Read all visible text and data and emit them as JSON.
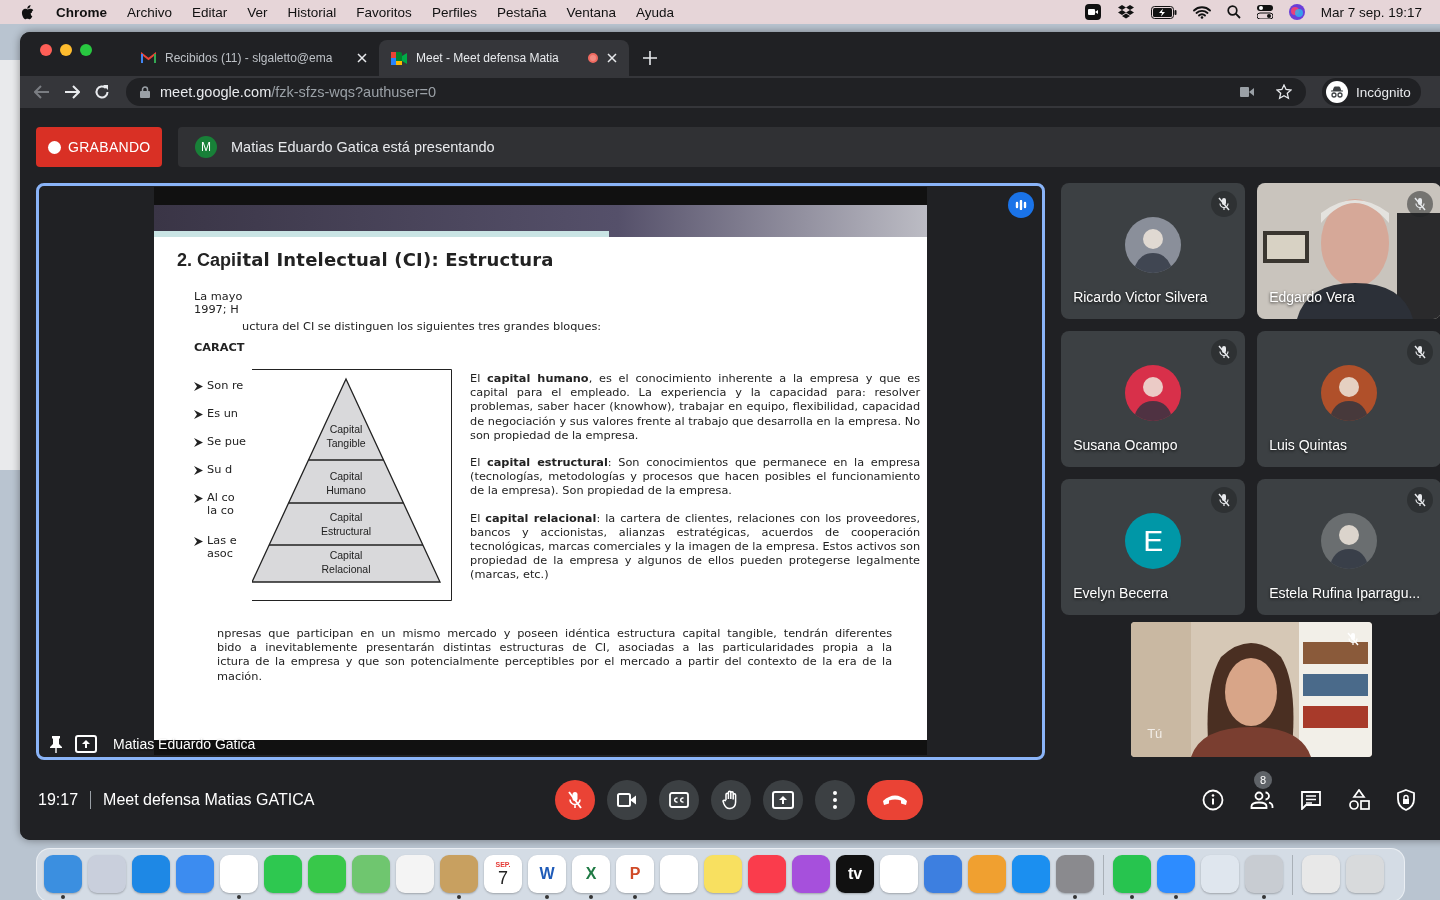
{
  "menubar": {
    "app": "Chrome",
    "items": [
      "Archivo",
      "Editar",
      "Ver",
      "Historial",
      "Favoritos",
      "Perfiles",
      "Pestaña",
      "Ventana",
      "Ayuda"
    ],
    "clock": "Mar 7 sep.  19:17"
  },
  "tabs": [
    {
      "kind": "mail",
      "title": "Recibidos (11) - slgaletto@ema",
      "selected": false,
      "recording": false
    },
    {
      "kind": "meet",
      "title": "Meet - Meet defensa Matia",
      "selected": true,
      "recording": true
    }
  ],
  "address": {
    "host": "meet.google.com",
    "path": "/fzk-sfzs-wqs?authuser=0",
    "profile": "Incógnito"
  },
  "meet": {
    "recording_label": "GRABANDO",
    "presenter_initial": "M",
    "presenter_text": "Matias Eduardo Gatica está presentando",
    "presenter_name": "Matias Eduardo Gatica",
    "time": "19:17",
    "meeting_title": "Meet defensa Matias GATICA",
    "people_count": "8",
    "mic_muted": true,
    "self_label": "Tú"
  },
  "slide": {
    "title_a": "2. Capi",
    "title_b": "ital Intelectual (CI): Estructura",
    "intro": "La mayo\n1997; H",
    "intro_2": "uctura del CI se distinguen los siguientes tres grandes bloques:",
    "heading": "CARACT",
    "bullets": [
      "Son re",
      "Es un",
      "Se pue",
      "Su d",
      "Al co\nla co",
      "Las e\nasoc"
    ],
    "pyramid": [
      "Capital\nTangible",
      "Capital\nHumano",
      "Capital\nEstructural",
      "Capital\nRelacional"
    ],
    "paragraphs": [
      "El **capital humano**, es el conocimiento inherente a la empresa y que es capital para el empleado. La experiencia y la capacidad para: resolver problemas, saber hacer (knowhow), trabajar en equipo, flexibilidad, capacidad de negociación y sus valores frente al trabajo que desarrolla en la empresa. No son propiedad de la empresa.",
      "El **capital estructural**: Son conocimientos que permanece en la empresa (tecnologías, metodologías y procesos que hacen posibles el funcionamiento de la empresa). Son propiedad de la empresa.",
      "El **capital relacional**: la cartera de clientes, relaciones con los proveedores, bancos y accionistas, alianzas estratégicas, acuerdos de cooperación tecnológicas, marcas comerciales y la imagen de la empresa. Estos activos son propiedad de la empresa y algunos de ellos pueden protegerse legalmente (marcas, etc.)"
    ],
    "bottom_lines": [
      "npresas que participan en un mismo mercado y poseen idéntica estructura capital tangible, tendrán diferentes",
      "bido a inevitablemente presentarán distintas estructuras de CI, asociadas a las particularidades propia a la",
      "ictura de la empresa y que son potencialmente perceptibles por el mercado a partir del contexto de la era de la",
      "mación."
    ]
  },
  "participants": [
    {
      "name": "Ricardo Victor Silvera",
      "muted": true,
      "color": "#8a8f9a"
    },
    {
      "name": "Edgardo Vera",
      "muted": true,
      "kind": "video",
      "color": "#c9c4bd"
    },
    {
      "name": "Susana Ocampo",
      "muted": true,
      "color": "#d8304a"
    },
    {
      "name": "Luis Quintas",
      "muted": true,
      "color": "#b0502a"
    },
    {
      "name": "Evelyn Becerra",
      "muted": true,
      "kind": "letter",
      "letter": "E",
      "color": "#0097a7"
    },
    {
      "name": "Estela Rufina Iparragu...",
      "muted": true,
      "color": "#6a6e70"
    }
  ],
  "dock": [
    {
      "color": "#3b8fe0",
      "running": true
    },
    {
      "color": "#c9cfdc",
      "running": false
    },
    {
      "color": "#1e88e5",
      "running": false
    },
    {
      "color": "#3c8cf0",
      "running": false
    },
    {
      "color": "#ffffff",
      "running": true
    },
    {
      "color": "#2ec850",
      "running": false
    },
    {
      "color": "#38c84a",
      "running": false
    },
    {
      "color": "#6fc66f",
      "running": false
    },
    {
      "color": "#f4f4f4",
      "running": false
    },
    {
      "color": "#c8a060",
      "running": true
    },
    {
      "color": "#ffffff",
      "running": false,
      "label": "SEP.",
      "sub": "7"
    },
    {
      "color": "#ffffff",
      "running": true,
      "label": "W"
    },
    {
      "color": "#ffffff",
      "running": true,
      "label": "X"
    },
    {
      "color": "#ffffff",
      "running": true,
      "label": "P"
    },
    {
      "color": "#ffffff",
      "running": false
    },
    {
      "color": "#f8e060",
      "running": false
    },
    {
      "color": "#fa3c4c",
      "running": false
    },
    {
      "color": "#a650dc",
      "running": false
    },
    {
      "color": "#111111",
      "running": false,
      "label": "tv"
    },
    {
      "color": "#ffffff",
      "running": false
    },
    {
      "color": "#3d7fe0",
      "running": false
    },
    {
      "color": "#f0a030",
      "running": false
    },
    {
      "color": "#1b8ff0",
      "running": false
    },
    {
      "color": "#8a8a8e",
      "running": true
    },
    {
      "color": "#27c44f",
      "running": true,
      "separator": true
    },
    {
      "color": "#2d8cff",
      "running": true
    },
    {
      "color": "#dfe6ee",
      "running": false
    },
    {
      "color": "#c8ccd2",
      "running": true
    },
    {
      "color": "#e8e8e8",
      "running": false,
      "separator": true
    },
    {
      "color": "#d8dadc",
      "running": false
    }
  ]
}
